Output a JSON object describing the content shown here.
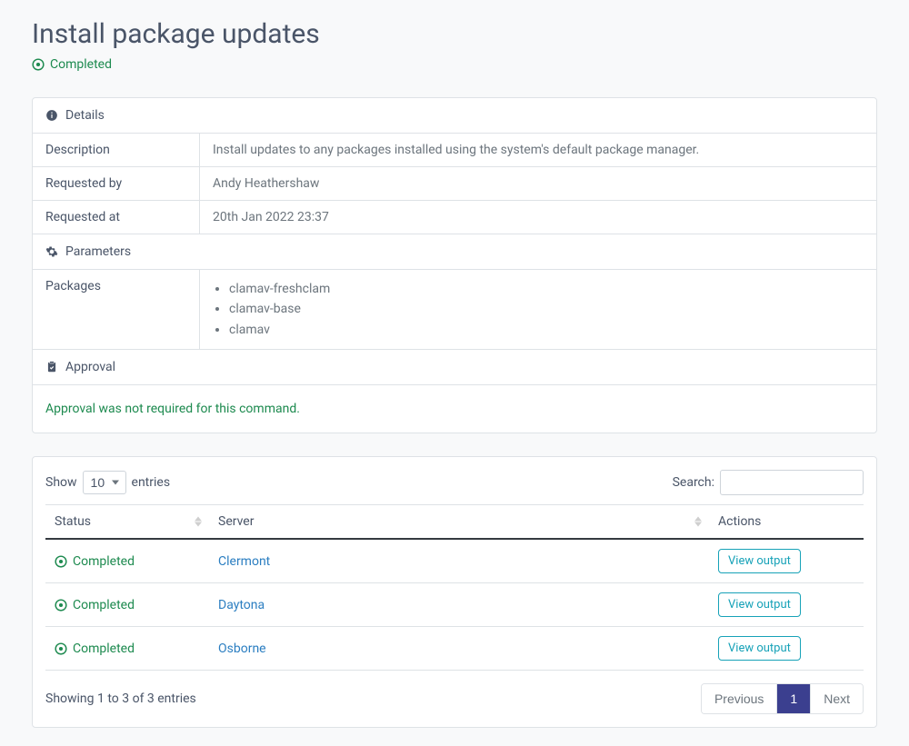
{
  "page_title": "Install package updates",
  "status": {
    "label": "Completed"
  },
  "details": {
    "section_title": "Details",
    "rows": {
      "description": {
        "label": "Description",
        "value": "Install updates to any packages installed using the system's default package manager."
      },
      "requested_by": {
        "label": "Requested by",
        "value": "Andy Heathershaw"
      },
      "requested_at": {
        "label": "Requested at",
        "value": "20th Jan 2022 23:37"
      }
    },
    "parameters": {
      "section_title": "Parameters",
      "packages_label": "Packages",
      "packages": [
        "clamav-freshclam",
        "clamav-base",
        "clamav"
      ]
    },
    "approval": {
      "section_title": "Approval",
      "message": "Approval was not required for this command."
    }
  },
  "table": {
    "show_label_prefix": "Show",
    "show_label_suffix": "entries",
    "show_value": "10",
    "search_label": "Search:",
    "search_value": "",
    "columns": {
      "status": "Status",
      "server": "Server",
      "actions": "Actions"
    },
    "rows": [
      {
        "status": "Completed",
        "server": "Clermont",
        "action": "View output"
      },
      {
        "status": "Completed",
        "server": "Daytona",
        "action": "View output"
      },
      {
        "status": "Completed",
        "server": "Osborne",
        "action": "View output"
      }
    ],
    "footer_info": "Showing 1 to 3 of 3 entries",
    "pagination": {
      "previous": "Previous",
      "next": "Next",
      "current": "1"
    }
  }
}
